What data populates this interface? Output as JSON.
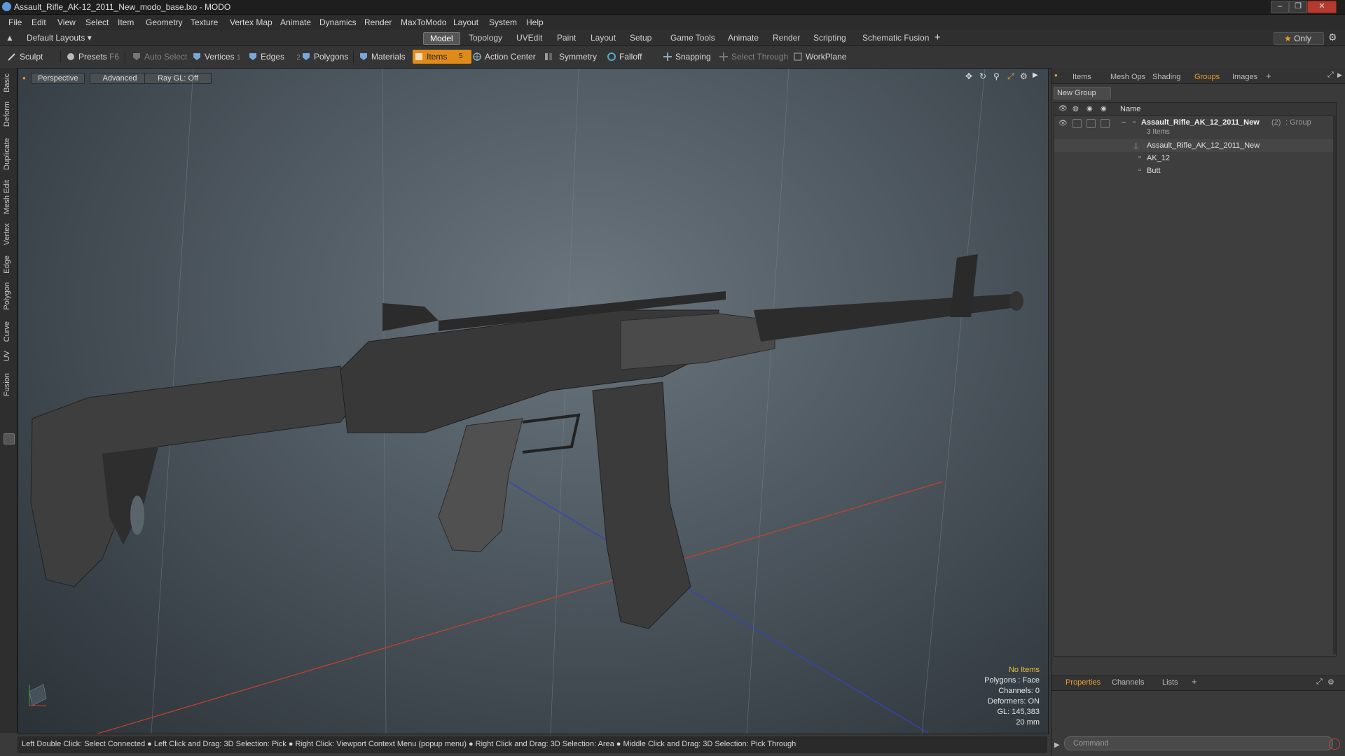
{
  "window": {
    "title": "Assault_Rifle_AK-12_2011_New_modo_base.lxo - MODO",
    "controls": [
      "minimize",
      "restore",
      "close"
    ]
  },
  "menu": [
    "File",
    "Edit",
    "View",
    "Select",
    "Item",
    "Geometry",
    "Texture",
    "Vertex Map",
    "Animate",
    "Dynamics",
    "Render",
    "MaxToModo",
    "Layout",
    "System",
    "Help"
  ],
  "layout_selector": "Default Layouts",
  "mode_tabs": [
    "Model",
    "Topology",
    "UVEdit",
    "Paint",
    "Layout",
    "Setup",
    "Game Tools",
    "Animate",
    "Render",
    "Scripting",
    "Schematic Fusion"
  ],
  "active_mode_tab": "Model",
  "only_label": "Only",
  "toolbar": {
    "sculpt": "Sculpt",
    "presets": "Presets",
    "presets_key": "F6",
    "auto_select": "Auto Select",
    "vertices": "Vertices",
    "vertices_key": "1",
    "edges": "Edges",
    "edges_key": "2",
    "polygons": "Polygons",
    "materials": "Materials",
    "items": "Items",
    "items_key": "5",
    "action_center": "Action Center",
    "symmetry": "Symmetry",
    "falloff": "Falloff",
    "snapping": "Snapping",
    "select_through": "Select Through",
    "workplane": "WorkPlane"
  },
  "left_tabs": [
    "Basic",
    "Deform",
    "Duplicate",
    "Mesh Edit",
    "Vertex",
    "Edge",
    "Polygon",
    "Curve",
    "UV",
    "Fusion"
  ],
  "viewport": {
    "view": "Perspective",
    "shading": "Advanced",
    "raygl": "Ray GL: Off",
    "info": {
      "selection": "No Items",
      "polygons": "Polygons : Face",
      "channels": "Channels: 0",
      "deformers": "Deformers: ON",
      "gl": "GL: 145,383",
      "scale": "20 mm"
    }
  },
  "status_hint": "Left Double Click: Select Connected ● Left Click and Drag: 3D Selection: Pick ● Right Click: Viewport Context Menu (popup menu) ● Right Click and Drag: 3D Selection: Area ● Middle Click and Drag: 3D Selection: Pick Through",
  "right_panel": {
    "tabs": [
      "Items",
      "Mesh Ops",
      "Shading",
      "Groups",
      "Images"
    ],
    "active_tab": "Groups",
    "new_group": "New Group",
    "column_name": "Name",
    "group": {
      "name": "Assault_Rifle_AK_12_2011_New",
      "count": "(2)",
      "type": ": Group",
      "items_count": "3 Items",
      "children": [
        "Assault_Rifle_AK_12_2011_New",
        "AK_12",
        "Butt"
      ]
    },
    "bottom_tabs": [
      "Properties",
      "Channels",
      "Lists"
    ],
    "bottom_active": "Properties",
    "command_placeholder": "Command"
  },
  "colors": {
    "accent": "#e08a1a",
    "active_tab_text": "#e8a030",
    "axis_x": "#d04030",
    "axis_z": "#3040c0"
  }
}
